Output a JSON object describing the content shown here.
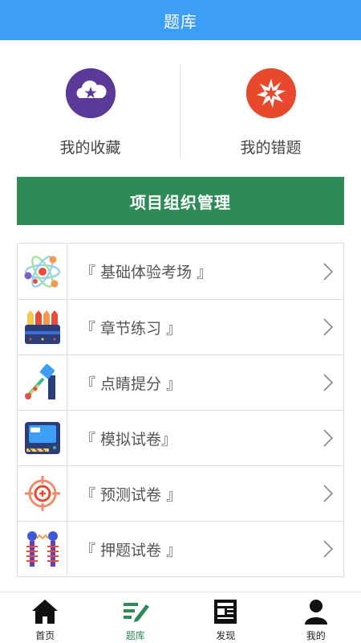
{
  "header": {
    "title": "题库"
  },
  "shortcuts": [
    {
      "label": "我的收藏",
      "icon": "cloud-star-icon",
      "color": "#5b3a9a"
    },
    {
      "label": "我的错题",
      "icon": "burst-icon",
      "color": "#e8492c"
    }
  ],
  "banner": {
    "label": "项目组织管理",
    "color": "#2e8b57"
  },
  "menu": [
    {
      "label": "『 基础体验考场 』",
      "icon": "atom-icon"
    },
    {
      "label": "『 章节练习 』",
      "icon": "pencils-icon"
    },
    {
      "label": "『 点睛提分 』",
      "icon": "telescope-icon"
    },
    {
      "label": "『 模拟试卷』",
      "icon": "monitor-icon"
    },
    {
      "label": "『 预测试卷 』",
      "icon": "target-icon"
    },
    {
      "label": "『 押题试卷 』",
      "icon": "spring-icon"
    }
  ],
  "tabs": [
    {
      "label": "首页",
      "icon": "home-icon"
    },
    {
      "label": "题库",
      "icon": "list-edit-icon",
      "active": true
    },
    {
      "label": "发现",
      "icon": "news-icon"
    },
    {
      "label": "我的",
      "icon": "user-icon"
    }
  ],
  "colors": {
    "topbar": "#3d9ef6",
    "accent": "#2e8b57"
  }
}
